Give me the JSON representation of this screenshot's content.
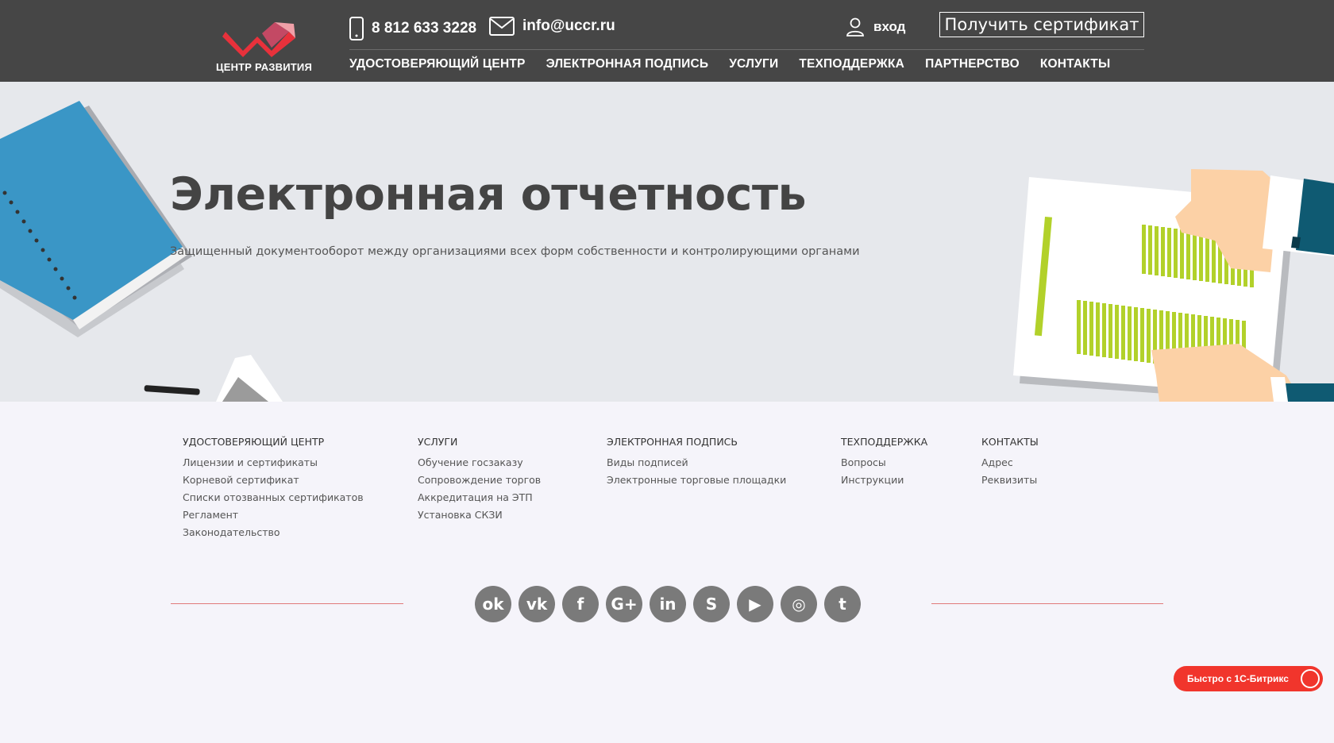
{
  "header": {
    "logo_text": "ЦЕНТР РАЗВИТИЯ",
    "phone": "8 812 633 3228",
    "email": "info@uccr.ru",
    "login_label": "вход",
    "cert_button": "Получить сертификат",
    "nav": [
      "УДОСТОВЕРЯЮЩИЙ ЦЕНТР",
      "ЭЛЕКТРОННАЯ ПОДПИСЬ",
      "УСЛУГИ",
      "ТЕХПОДДЕРЖКА",
      "ПАРТНЕРСТВО",
      "КОНТАКТЫ"
    ]
  },
  "hero": {
    "title": "Электронная отчетность",
    "subtitle": "Защищенный документооборот между организациями всех форм собственности и контролирующими органами"
  },
  "footer": {
    "columns": [
      {
        "title": "УДОСТОВЕРЯЮЩИЙ ЦЕНТР",
        "items": [
          "Лицензии и сертификаты",
          "Корневой сертификат",
          "Списки отозванных сертификатов",
          "Регламент",
          "Законодательство"
        ]
      },
      {
        "title": "УСЛУГИ",
        "items": [
          "Обучение госзаказу",
          "Сопровождение торгов",
          "Аккредитация на ЭТП",
          "Установка СКЗИ"
        ]
      },
      {
        "title": "ЭЛЕКТРОННАЯ ПОДПИСЬ",
        "items": [
          "Виды подписей",
          "Электронные торговые площадки"
        ]
      },
      {
        "title": "ТЕХПОДДЕРЖКА",
        "items": [
          "Вопросы",
          "Инструкции"
        ]
      },
      {
        "title": "КОНТАКТЫ",
        "items": [
          "Адрес",
          "Реквизиты"
        ]
      }
    ],
    "social": [
      {
        "icon": "odnoklassniki-icon",
        "glyph": "ok"
      },
      {
        "icon": "vk-icon",
        "glyph": "vk"
      },
      {
        "icon": "facebook-icon",
        "glyph": "f"
      },
      {
        "icon": "google-plus-icon",
        "glyph": "G+"
      },
      {
        "icon": "linkedin-icon",
        "glyph": "in"
      },
      {
        "icon": "skype-icon",
        "glyph": "S"
      },
      {
        "icon": "youtube-icon",
        "glyph": "▶"
      },
      {
        "icon": "instagram-icon",
        "glyph": "◎"
      },
      {
        "icon": "twitter-icon",
        "glyph": "t"
      }
    ],
    "bitrix_badge": "Быстро с 1С-Битрикс"
  },
  "colors": {
    "header_bg": "#464646",
    "hero_bg": "#e6e8ec",
    "footer_bg": "#f5f4fa",
    "accent_red": "#f1352c",
    "separator": "#e07a7a",
    "social_bg": "#7a7a7a"
  }
}
